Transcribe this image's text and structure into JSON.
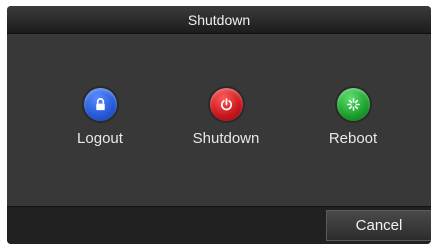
{
  "dialog": {
    "title": "Shutdown",
    "actions": [
      {
        "label": "Logout",
        "icon": "lock-icon",
        "color": "#2459d6"
      },
      {
        "label": "Shutdown",
        "icon": "power-icon",
        "color": "#c8161b"
      },
      {
        "label": "Reboot",
        "icon": "reboot-icon",
        "color": "#1a9e2c"
      }
    ],
    "cancel_label": "Cancel"
  }
}
